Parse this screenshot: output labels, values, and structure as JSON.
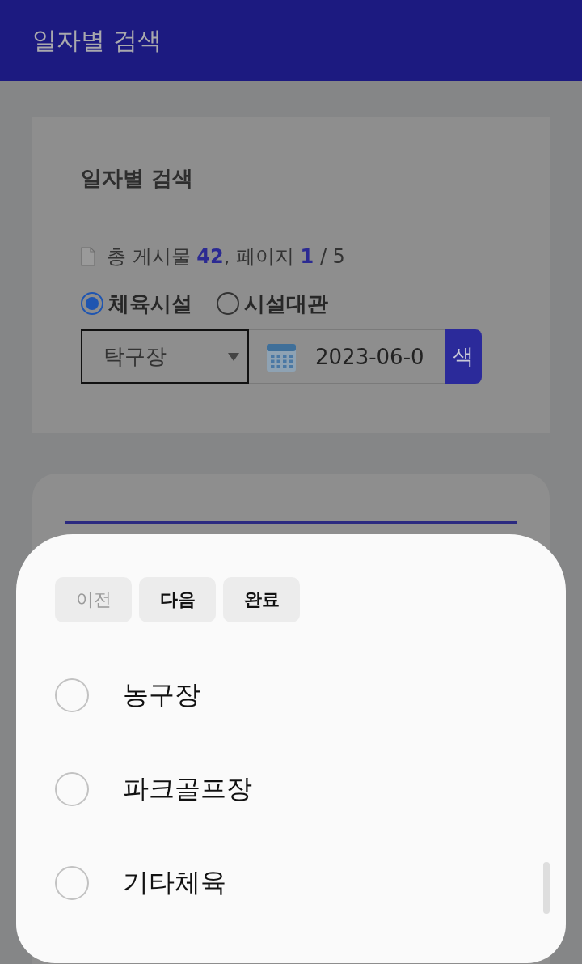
{
  "app_bar": {
    "title": "일자별 검색"
  },
  "search_card": {
    "title": "일자별 검색",
    "summary": "총 게시물 **42**, 페이지 **1** / 5",
    "categories": [
      {
        "label": "체육시설",
        "selected": true
      },
      {
        "label": "시설대관",
        "selected": false
      }
    ],
    "facility_select": {
      "value": "탁구장"
    },
    "date_field": {
      "value": "2023-06-0"
    },
    "search_button": {
      "label": "색"
    }
  },
  "picker_sheet": {
    "buttons": [
      {
        "label": "이전",
        "disabled": true
      },
      {
        "label": "다음",
        "disabled": false
      },
      {
        "label": "완료",
        "disabled": false
      }
    ],
    "options": [
      {
        "label": "농구장",
        "selected": false
      },
      {
        "label": "파크골프장",
        "selected": false
      },
      {
        "label": "기타체육",
        "selected": false
      }
    ]
  }
}
